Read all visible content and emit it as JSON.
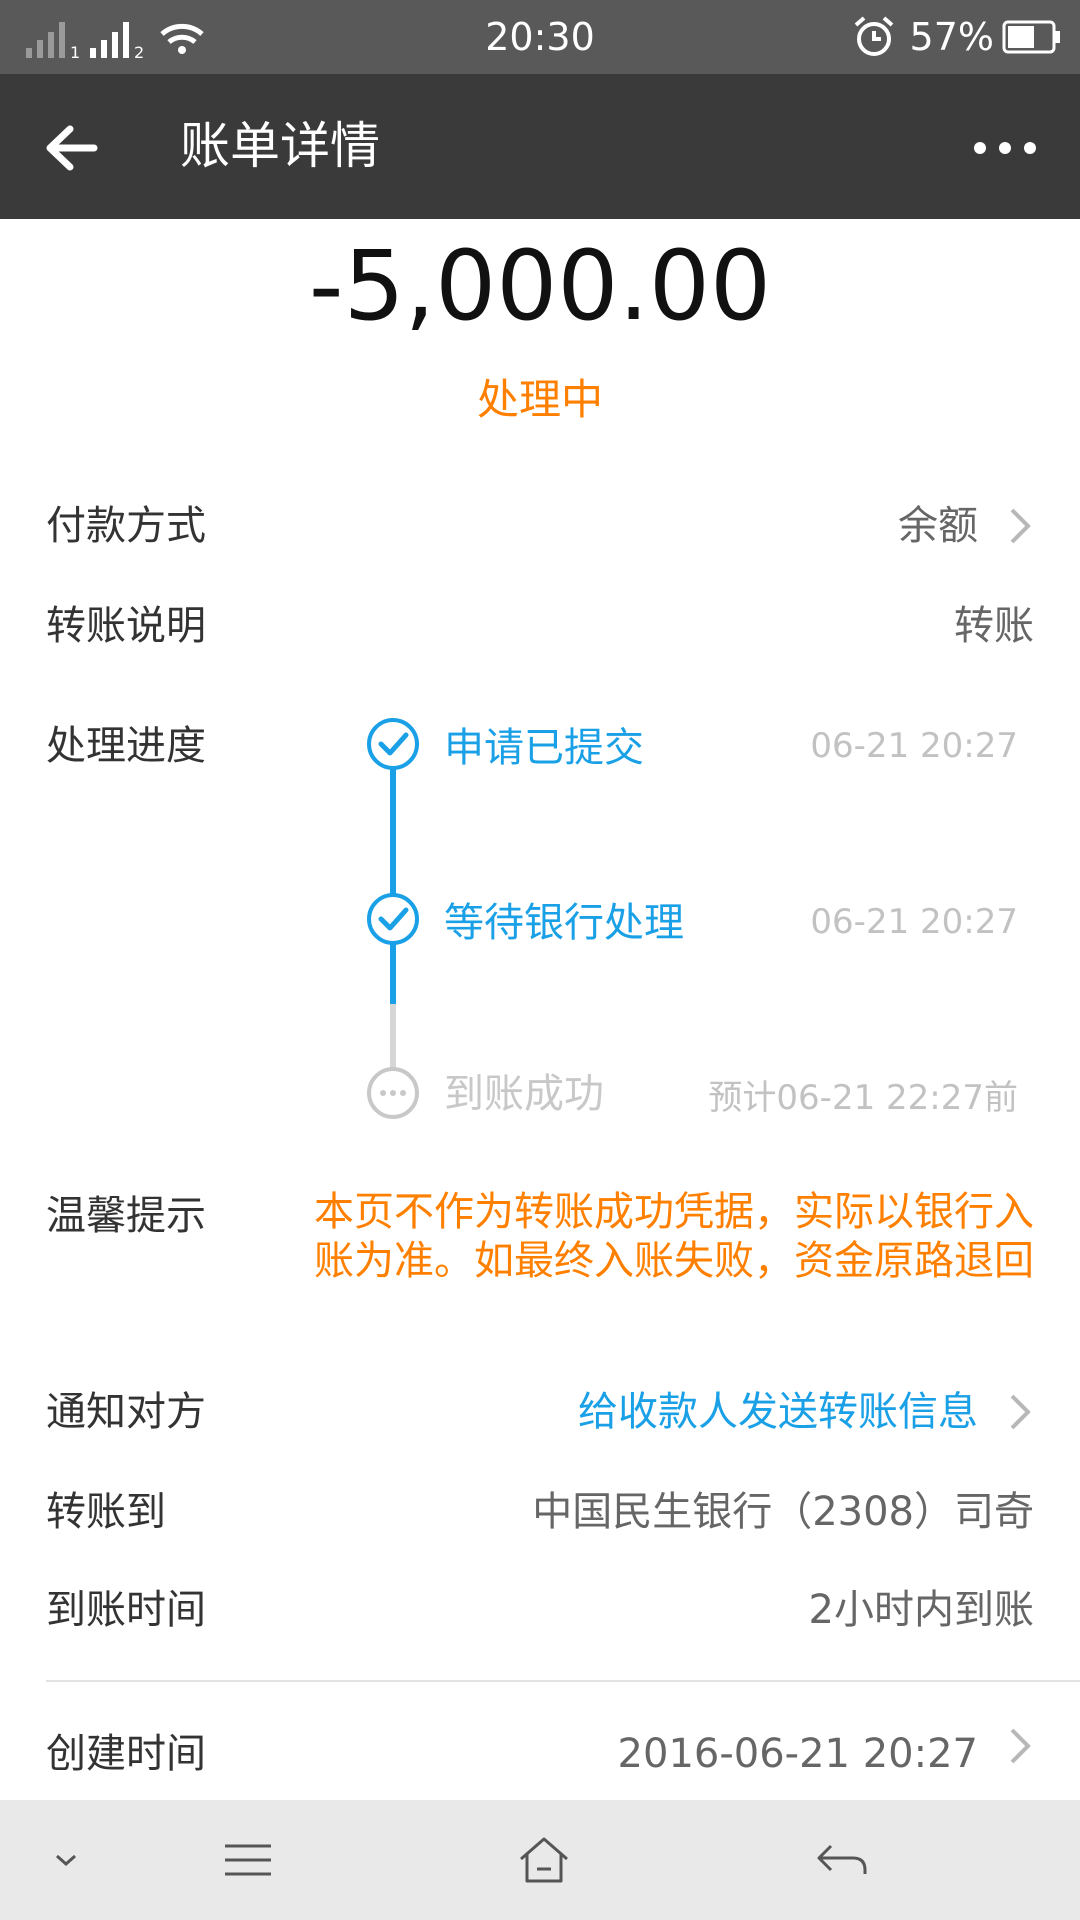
{
  "status_bar": {
    "time": "20:30",
    "battery_percent": "57%",
    "sim1_label": "1",
    "sim2_label": "2"
  },
  "header": {
    "title": "账单详情",
    "back_icon": "arrow-left-icon",
    "more_icon": "more-dots-icon"
  },
  "bill": {
    "amount": "-5,000.00",
    "status": "处理中"
  },
  "rows": {
    "payment_method": {
      "label": "付款方式",
      "value": "余额"
    },
    "transfer_note": {
      "label": "转账说明",
      "value": "转账"
    },
    "progress": {
      "label": "处理进度"
    },
    "tip": {
      "label": "温馨提示",
      "value": "本页不作为转账成功凭据，实际以银行入账为准。如最终入账失败，资金原路退回"
    },
    "notify": {
      "label": "通知对方",
      "value": "给收款人发送转账信息"
    },
    "transfer_to": {
      "label": "转账到",
      "value": "中国民生银行（2308）司奇"
    },
    "arrival_time": {
      "label": "到账时间",
      "value": "2小时内到账"
    },
    "created_time": {
      "label": "创建时间",
      "value": "2016-06-21 20:27"
    }
  },
  "progress_steps": [
    {
      "label": "申请已提交",
      "time": "06-21 20:27",
      "state": "done"
    },
    {
      "label": "等待银行处理",
      "time": "06-21 20:27",
      "state": "done"
    },
    {
      "label": "到账成功",
      "time": "预计06-21 22:27前",
      "state": "pending"
    }
  ],
  "colors": {
    "accent_blue": "#1aa0e6",
    "warning_orange": "#ff8000",
    "pending_gray": "#c8c8c8",
    "appbar_bg": "#3a3a3a",
    "statusbar_bg": "#595959"
  },
  "nav_bar": {
    "icons": [
      "chevron-down-icon",
      "menu-icon",
      "home-icon",
      "back-icon"
    ]
  }
}
